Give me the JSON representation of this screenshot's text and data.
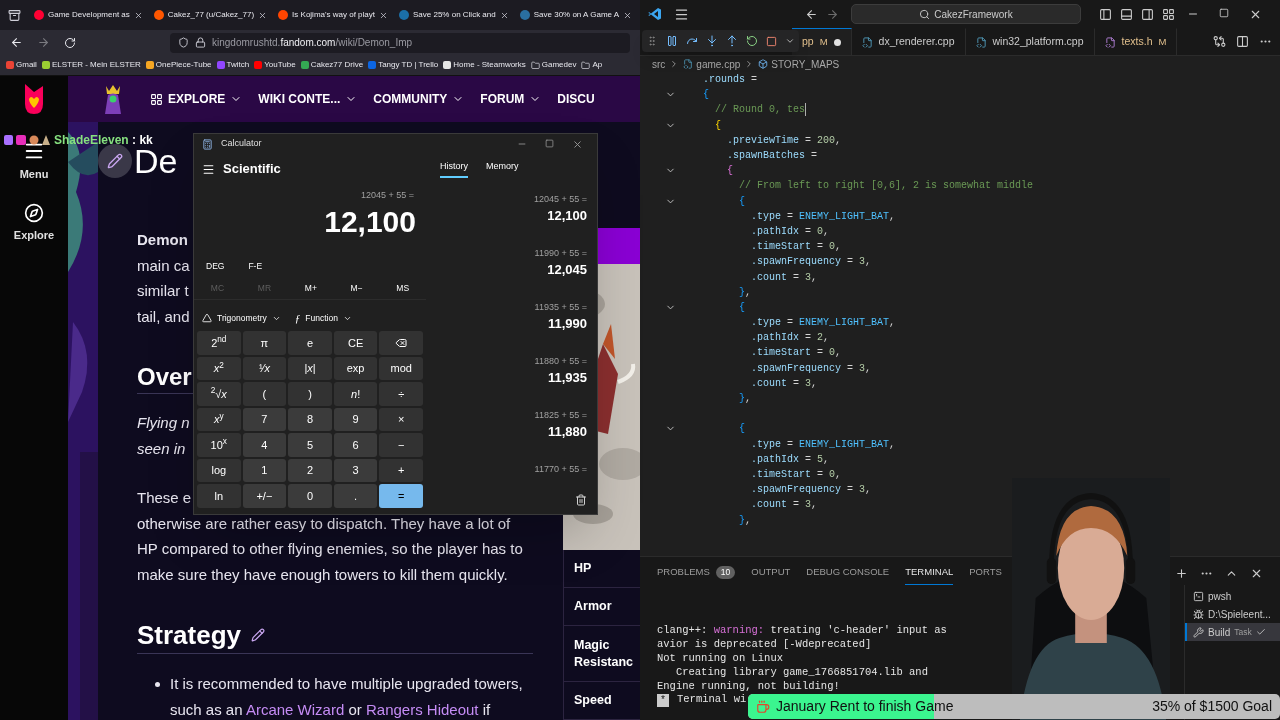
{
  "browser": {
    "tabs": [
      {
        "title": "Game Development as",
        "color": "#ff0033"
      },
      {
        "title": "Cakez_77 (u/Cakez_77)",
        "color": "#ff5700"
      },
      {
        "title": "Is Kojima's way of playt",
        "color": "#ff4500"
      },
      {
        "title": "Save 25% on Click and",
        "color": "#1b6fa8"
      },
      {
        "title": "Save 30% on A Game A",
        "color": "#2a6fa0"
      }
    ],
    "address": {
      "subdomain": "kingdomrushtd.",
      "domain": "fandom.com",
      "path": "/wiki/Demon_Imp"
    },
    "bookmarks": [
      {
        "label": "Gmail",
        "kind": "site",
        "color": "#ea4335"
      },
      {
        "label": "ELSTER - Mein ELSTER",
        "kind": "site",
        "color": "#9acd32"
      },
      {
        "label": "OnePiece-Tube",
        "kind": "site",
        "color": "#f5a623"
      },
      {
        "label": "Twitch",
        "kind": "site",
        "color": "#9146ff"
      },
      {
        "label": "YouTube",
        "kind": "site",
        "color": "#ff0000"
      },
      {
        "label": "Cakez77 Drive",
        "kind": "site",
        "color": "#34a853"
      },
      {
        "label": "Tangy TD | Trello",
        "kind": "site",
        "color": "#0c66e4"
      },
      {
        "label": "Home - Steamworks",
        "kind": "site",
        "color": "#e6e6e6"
      },
      {
        "label": "Gamedev",
        "kind": "folder"
      },
      {
        "label": "Ap",
        "kind": "folder"
      }
    ]
  },
  "wiki": {
    "rail": [
      {
        "label": "Menu",
        "kind": "menu"
      },
      {
        "label": "Explore",
        "kind": "explore"
      }
    ],
    "nav": [
      {
        "label": "EXPLORE",
        "kind": "explore"
      },
      {
        "label": "WIKI CONTE...",
        "kind": "plain"
      },
      {
        "label": "COMMUNITY",
        "kind": "plain"
      },
      {
        "label": "FORUM",
        "kind": "plain"
      },
      {
        "label": "DISCU",
        "kind": "cut"
      }
    ],
    "title": "De",
    "intro": [
      {
        "text": "Demon",
        "bold": true
      },
      {
        "text": "main ca",
        "bold": false
      },
      {
        "text": "similar t",
        "bold": false
      },
      {
        "text": "tail, and",
        "bold": false
      }
    ],
    "overview": {
      "heading": "Over",
      "italic_lines": [
        "Flying n",
        "seen in"
      ],
      "paragraph_lines": [
        "These e",
        "otherwise are rather easy to dispatch. They have a lot of",
        "HP compared to other flying enemies, so the player has to",
        "make sure they have enough towers to kill them quickly."
      ]
    },
    "strategy": {
      "heading": "Strategy",
      "bullets": [
        [
          {
            "text": "It is recommended to have multiple upgraded towers, such as an ",
            "link": false
          },
          {
            "text": "Arcane Wizard",
            "link": true
          },
          {
            "text": " or ",
            "link": false
          },
          {
            "text": "Rangers Hideout",
            "link": true
          },
          {
            "text": " if",
            "link": false
          }
        ]
      ]
    },
    "infobox": {
      "rows": [
        "HP",
        "Armor",
        "Magic Resistanc",
        "Speed"
      ]
    }
  },
  "chat": {
    "user": "ShadeEleven",
    "separator": ":",
    "message": "kk"
  },
  "calculator": {
    "title": "Calculator",
    "mode": "Scientific",
    "expression": "12045 + 55 =",
    "display": "12,100",
    "toggles": [
      "DEG",
      "F-E"
    ],
    "memory": [
      {
        "label": "MC",
        "disabled": true
      },
      {
        "label": "MR",
        "disabled": true
      },
      {
        "label": "M+",
        "disabled": false
      },
      {
        "label": "M−",
        "disabled": false
      },
      {
        "label": "MS",
        "disabled": false
      }
    ],
    "menus": [
      {
        "label": "Trigonometry",
        "kind": "trig"
      },
      {
        "label": "Function",
        "kind": "function",
        "symbol": "ƒ"
      }
    ],
    "keys": [
      {
        "label": "2$^{nd}$",
        "kind": "fn"
      },
      {
        "label": "π",
        "kind": "fn"
      },
      {
        "label": "e",
        "kind": "fn"
      },
      {
        "label": "CE",
        "kind": "fn"
      },
      {
        "kind": "backspace"
      },
      {
        "label": "*x*$^{2}$",
        "kind": "fn"
      },
      {
        "label": "¹⁄*x*",
        "kind": "fn"
      },
      {
        "label": "|*x*|",
        "kind": "fn"
      },
      {
        "label": "exp",
        "kind": "fn"
      },
      {
        "label": "mod",
        "kind": "fn"
      },
      {
        "label": "$^{2}$√*x*",
        "kind": "fn"
      },
      {
        "label": "(",
        "kind": "fn"
      },
      {
        "label": ")",
        "kind": "fn"
      },
      {
        "label": "*n*!",
        "kind": "fn"
      },
      {
        "label": "÷",
        "kind": "fn"
      },
      {
        "label": "*x*$^{y}$",
        "kind": "fn"
      },
      {
        "label": "7",
        "kind": "digit"
      },
      {
        "label": "8",
        "kind": "digit"
      },
      {
        "label": "9",
        "kind": "digit"
      },
      {
        "label": "×",
        "kind": "fn"
      },
      {
        "label": "10$^{x}$",
        "kind": "fn"
      },
      {
        "label": "4",
        "kind": "digit"
      },
      {
        "label": "5",
        "kind": "digit"
      },
      {
        "label": "6",
        "kind": "digit"
      },
      {
        "label": "−",
        "kind": "fn"
      },
      {
        "label": "log",
        "kind": "fn"
      },
      {
        "label": "1",
        "kind": "digit"
      },
      {
        "label": "2",
        "kind": "digit"
      },
      {
        "label": "3",
        "kind": "digit"
      },
      {
        "label": "+",
        "kind": "fn"
      },
      {
        "label": "ln",
        "kind": "fn"
      },
      {
        "label": "+/−",
        "kind": "digit"
      },
      {
        "label": "0",
        "kind": "digit"
      },
      {
        "label": ".",
        "kind": "digit"
      },
      {
        "label": "=",
        "kind": "equals"
      }
    ],
    "panel_tabs": [
      {
        "label": "History",
        "selected": true
      },
      {
        "label": "Memory",
        "selected": false
      }
    ],
    "history": [
      {
        "expression": "12045 + 55 =",
        "result": "12,100"
      },
      {
        "expression": "11990 + 55 =",
        "result": "12,045"
      },
      {
        "expression": "11935 + 55 =",
        "result": "11,990"
      },
      {
        "expression": "11880 + 55 =",
        "result": "11,935"
      },
      {
        "expression": "11825 + 55 =",
        "result": "11,880"
      },
      {
        "expression": "11770 + 55 ="
      }
    ]
  },
  "editor": {
    "search": "CakezFramework",
    "tabs": [
      {
        "name": "pp",
        "status": "M",
        "dirty": true,
        "selected": true
      },
      {
        "name": "dx_renderer.cpp",
        "dirty": false,
        "selected": false,
        "kind": "cpp"
      },
      {
        "name": "win32_platform.cpp",
        "dirty": false,
        "selected": false,
        "kind": "cpp"
      },
      {
        "name": "texts.h",
        "status": "M",
        "dirty": false,
        "selected": false,
        "kind": "h"
      }
    ],
    "breadcrumb": [
      {
        "label": "src",
        "kind": "folder"
      },
      {
        "label": "game.cpp",
        "kind": "cpp"
      },
      {
        "label": "STORY_MAPS",
        "kind": "symbol"
      }
    ],
    "lines": [
      {
        "text": ".rounds =",
        "fold": false,
        "cursor": false
      },
      {
        "text": "{",
        "fold": true,
        "cursor": false
      },
      {
        "text": "  // Round 0, tes",
        "fold": false,
        "cursor": true
      },
      {
        "text": "  {",
        "fold": true,
        "cursor": false
      },
      {
        "text": "    .previewTime = 200,",
        "fold": false,
        "cursor": false
      },
      {
        "text": "    .spawnBatches =",
        "fold": false,
        "cursor": false
      },
      {
        "text": "    {",
        "fold": true,
        "cursor": false
      },
      {
        "text": "      // From left to right [0,6], 2 is somewhat middle",
        "fold": false,
        "cursor": false
      },
      {
        "text": "      {",
        "fold": true,
        "cursor": false
      },
      {
        "text": "        .type = ENEMY_LIGHT_BAT,",
        "fold": false,
        "cursor": false
      },
      {
        "text": "        .pathIdx = 0,",
        "fold": false,
        "cursor": false
      },
      {
        "text": "        .timeStart = 0,",
        "fold": false,
        "cursor": false
      },
      {
        "text": "        .spawnFrequency = 3,",
        "fold": false,
        "cursor": false
      },
      {
        "text": "        .count = 3,",
        "fold": false,
        "cursor": false
      },
      {
        "text": "      },",
        "fold": false,
        "cursor": false
      },
      {
        "text": "      {",
        "fold": true,
        "cursor": false
      },
      {
        "text": "        .type = ENEMY_LIGHT_BAT,",
        "fold": false,
        "cursor": false
      },
      {
        "text": "        .pathIdx = 2,",
        "fold": false,
        "cursor": false
      },
      {
        "text": "        .timeStart = 0,",
        "fold": false,
        "cursor": false
      },
      {
        "text": "        .spawnFrequency = 3,",
        "fold": false,
        "cursor": false
      },
      {
        "text": "        .count = 3,",
        "fold": false,
        "cursor": false
      },
      {
        "text": "      },",
        "fold": false,
        "cursor": false
      },
      {
        "kind": "blank"
      },
      {
        "text": "      {",
        "fold": true,
        "cursor": false
      },
      {
        "text": "        .type = ENEMY_LIGHT_BAT,",
        "fold": false,
        "cursor": false
      },
      {
        "text": "        .pathIdx = 5,",
        "fold": false,
        "cursor": false
      },
      {
        "text": "        .timeStart = 0,",
        "fold": false,
        "cursor": false
      },
      {
        "text": "        .spawnFrequency = 3,",
        "fold": false,
        "cursor": false
      },
      {
        "text": "        .count = 3,",
        "fold": false,
        "cursor": false
      },
      {
        "text": "      },",
        "fold": false,
        "cursor": false
      }
    ]
  },
  "panel": {
    "tabs": [
      {
        "label": "PROBLEMS",
        "badge": "10",
        "selected": false
      },
      {
        "label": "OUTPUT",
        "selected": false
      },
      {
        "label": "DEBUG CONSOLE",
        "selected": false
      },
      {
        "label": "TERMINAL",
        "selected": true
      },
      {
        "label": "PORTS",
        "selected": false
      }
    ],
    "terminal": [
      [
        {
          "text": "clang++: ",
          "kind": "plain"
        },
        {
          "text": "warning:",
          "kind": "warning"
        },
        {
          "text": " treating 'c-header' input as",
          "kind": "plain"
        }
      ],
      [
        {
          "text": "avior is deprecated [-Wdeprecated]",
          "kind": "plain"
        }
      ],
      [
        {
          "text": "Not running on Linux",
          "kind": "plain"
        }
      ],
      [
        {
          "text": "   Creating library game_1766851704.lib and",
          "kind": "plain"
        }
      ],
      [
        {
          "text": "Engine running, not building!",
          "kind": "plain"
        }
      ]
    ],
    "prompt": {
      "marker": "*",
      "text": "Terminal wi"
    },
    "sessions": [
      {
        "label": "pwsh",
        "kind": "shell",
        "selected": false
      },
      {
        "label": "D:\\Spieleent...",
        "kind": "debug",
        "selected": false
      },
      {
        "label": "Build",
        "detail": "Task",
        "kind": "task",
        "selected": true
      }
    ]
  },
  "donation": {
    "title": "January Rent to finish Game",
    "goal": "35% of $1500 Goal",
    "level": 0.35
  }
}
